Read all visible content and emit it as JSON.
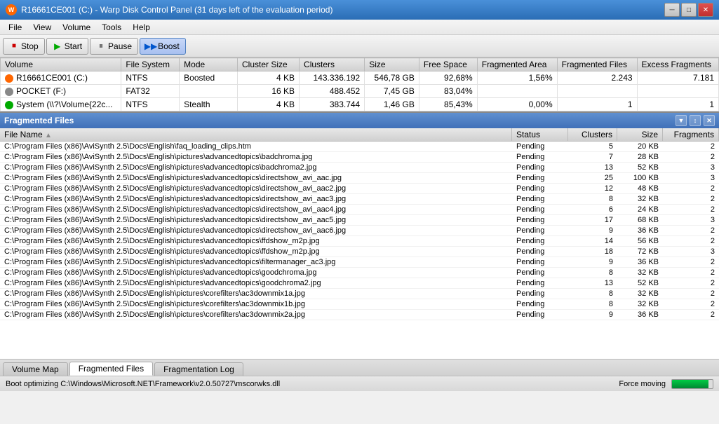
{
  "titleBar": {
    "title": "R16661CE001 (C:) - Warp Disk Control Panel (31 days left of the evaluation period)",
    "icon": "W"
  },
  "menuBar": {
    "items": [
      "File",
      "View",
      "Volume",
      "Tools",
      "Help"
    ]
  },
  "toolbar": {
    "stop": "Stop",
    "start": "Start",
    "pause": "Pause",
    "boost": "Boost"
  },
  "volumeTable": {
    "headers": [
      "Volume",
      "File System",
      "Mode",
      "Cluster Size",
      "Clusters",
      "Size",
      "Free Space",
      "Fragmented Area",
      "Fragmented Files",
      "Excess Fragments"
    ],
    "rows": [
      {
        "icon": "orange",
        "volume": "R16661CE001 (C:)",
        "fs": "NTFS",
        "mode": "Boosted",
        "clusterSize": "4 KB",
        "clusters": "143.336.192",
        "size": "546,78 GB",
        "freeSpace": "92,68%",
        "fragArea": "1,56%",
        "fragFiles": "2.243",
        "excessFrags": "7.181"
      },
      {
        "icon": "gray",
        "volume": "POCKET (F:)",
        "fs": "FAT32",
        "mode": "",
        "clusterSize": "16 KB",
        "clusters": "488.452",
        "size": "7,45 GB",
        "freeSpace": "83,04%",
        "fragArea": "",
        "fragFiles": "",
        "excessFrags": ""
      },
      {
        "icon": "green",
        "volume": "System (\\\\?\\Volume{22c...",
        "fs": "NTFS",
        "mode": "Stealth",
        "clusterSize": "4 KB",
        "clusters": "383.744",
        "size": "1,46 GB",
        "freeSpace": "85,43%",
        "fragArea": "0,00%",
        "fragFiles": "1",
        "excessFrags": "1"
      }
    ]
  },
  "fragSection": {
    "title": "Fragmented Files",
    "icons": [
      "▼",
      "↕",
      "✕"
    ]
  },
  "fileList": {
    "headers": {
      "name": "File Name",
      "sortArrow": "▲",
      "status": "Status",
      "clusters": "Clusters",
      "size": "Size",
      "fragments": "Fragments"
    },
    "rows": [
      {
        "name": "C:\\Program Files (x86)\\AviSynth 2.5\\Docs\\English\\faq_loading_clips.htm",
        "status": "Pending",
        "clusters": "5",
        "size": "20 KB",
        "frags": "2"
      },
      {
        "name": "C:\\Program Files (x86)\\AviSynth 2.5\\Docs\\English\\pictures\\advancedtopics\\badchroma.jpg",
        "status": "Pending",
        "clusters": "7",
        "size": "28 KB",
        "frags": "2"
      },
      {
        "name": "C:\\Program Files (x86)\\AviSynth 2.5\\Docs\\English\\pictures\\advancedtopics\\badchroma2.jpg",
        "status": "Pending",
        "clusters": "13",
        "size": "52 KB",
        "frags": "3"
      },
      {
        "name": "C:\\Program Files (x86)\\AviSynth 2.5\\Docs\\English\\pictures\\advancedtopics\\directshow_avi_aac.jpg",
        "status": "Pending",
        "clusters": "25",
        "size": "100 KB",
        "frags": "3"
      },
      {
        "name": "C:\\Program Files (x86)\\AviSynth 2.5\\Docs\\English\\pictures\\advancedtopics\\directshow_avi_aac2.jpg",
        "status": "Pending",
        "clusters": "12",
        "size": "48 KB",
        "frags": "2"
      },
      {
        "name": "C:\\Program Files (x86)\\AviSynth 2.5\\Docs\\English\\pictures\\advancedtopics\\directshow_avi_aac3.jpg",
        "status": "Pending",
        "clusters": "8",
        "size": "32 KB",
        "frags": "2"
      },
      {
        "name": "C:\\Program Files (x86)\\AviSynth 2.5\\Docs\\English\\pictures\\advancedtopics\\directshow_avi_aac4.jpg",
        "status": "Pending",
        "clusters": "6",
        "size": "24 KB",
        "frags": "2"
      },
      {
        "name": "C:\\Program Files (x86)\\AviSynth 2.5\\Docs\\English\\pictures\\advancedtopics\\directshow_avi_aac5.jpg",
        "status": "Pending",
        "clusters": "17",
        "size": "68 KB",
        "frags": "3"
      },
      {
        "name": "C:\\Program Files (x86)\\AviSynth 2.5\\Docs\\English\\pictures\\advancedtopics\\directshow_avi_aac6.jpg",
        "status": "Pending",
        "clusters": "9",
        "size": "36 KB",
        "frags": "2"
      },
      {
        "name": "C:\\Program Files (x86)\\AviSynth 2.5\\Docs\\English\\pictures\\advancedtopics\\ffdshow_m2p.jpg",
        "status": "Pending",
        "clusters": "14",
        "size": "56 KB",
        "frags": "2"
      },
      {
        "name": "C:\\Program Files (x86)\\AviSynth 2.5\\Docs\\English\\pictures\\advancedtopics\\ffdshow_m2p.jpg",
        "status": "Pending",
        "clusters": "18",
        "size": "72 KB",
        "frags": "3"
      },
      {
        "name": "C:\\Program Files (x86)\\AviSynth 2.5\\Docs\\English\\pictures\\advancedtopics\\filtermanager_ac3.jpg",
        "status": "Pending",
        "clusters": "9",
        "size": "36 KB",
        "frags": "2"
      },
      {
        "name": "C:\\Program Files (x86)\\AviSynth 2.5\\Docs\\English\\pictures\\advancedtopics\\goodchroma.jpg",
        "status": "Pending",
        "clusters": "8",
        "size": "32 KB",
        "frags": "2"
      },
      {
        "name": "C:\\Program Files (x86)\\AviSynth 2.5\\Docs\\English\\pictures\\advancedtopics\\goodchroma2.jpg",
        "status": "Pending",
        "clusters": "13",
        "size": "52 KB",
        "frags": "2"
      },
      {
        "name": "C:\\Program Files (x86)\\AviSynth 2.5\\Docs\\English\\pictures\\corefilters\\ac3downmix1a.jpg",
        "status": "Pending",
        "clusters": "8",
        "size": "32 KB",
        "frags": "2"
      },
      {
        "name": "C:\\Program Files (x86)\\AviSynth 2.5\\Docs\\English\\pictures\\corefilters\\ac3downmix1b.jpg",
        "status": "Pending",
        "clusters": "8",
        "size": "32 KB",
        "frags": "2"
      },
      {
        "name": "C:\\Program Files (x86)\\AviSynth 2.5\\Docs\\English\\pictures\\corefilters\\ac3downmix2a.jpg",
        "status": "Pending",
        "clusters": "9",
        "size": "36 KB",
        "frags": "2"
      }
    ]
  },
  "bottomTabs": {
    "tabs": [
      "Volume Map",
      "Fragmented Files",
      "Fragmentation Log"
    ],
    "active": 1
  },
  "statusBar": {
    "text": "Boot optimizing C:\\Windows\\Microsoft.NET\\Framework\\v2.0.50727\\mscorwks.dll",
    "rightLabel": "Force moving",
    "progress": 90
  }
}
